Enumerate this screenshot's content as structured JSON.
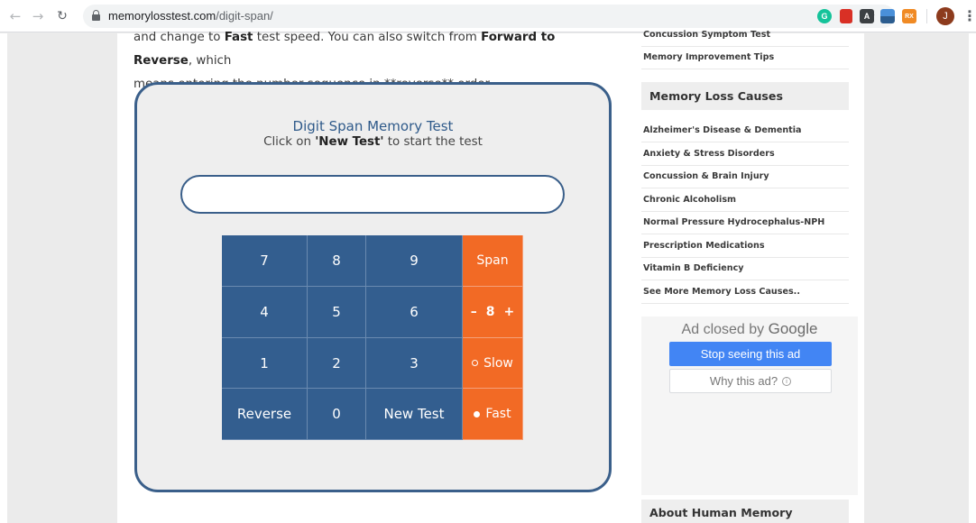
{
  "browser": {
    "url_host": "memorylosstest.com",
    "url_path": "/digit-span/",
    "profile_initial": "J",
    "extensions": [
      "grammarly-icon",
      "red-extension-icon",
      "a-extension-icon",
      "photo-extension-icon",
      "rx-extension-icon"
    ],
    "ext_rx_label": "RX",
    "ext_a_label": "A"
  },
  "article": {
    "line1_pre": "and change to ",
    "line1_bold1": "Fast",
    "line1_mid": " test speed. You can also switch from ",
    "line1_bold2": "Forward to Reverse",
    "line1_post": ", which",
    "line2": "means entering the number sequence in **reverse** order."
  },
  "test": {
    "title": "Digit Span Memory Test",
    "subtitle_pre": "Click on ",
    "subtitle_bold": "'New Test'",
    "subtitle_post": " to start the test",
    "display_value": ""
  },
  "keypad": {
    "keys": [
      {
        "label": "7",
        "name": "key-7"
      },
      {
        "label": "8",
        "name": "key-8"
      },
      {
        "label": "9",
        "name": "key-9"
      },
      {
        "label": "4",
        "name": "key-4"
      },
      {
        "label": "5",
        "name": "key-5"
      },
      {
        "label": "6",
        "name": "key-6"
      },
      {
        "label": "1",
        "name": "key-1"
      },
      {
        "label": "2",
        "name": "key-2"
      },
      {
        "label": "3",
        "name": "key-3"
      },
      {
        "label": "Reverse",
        "name": "reverse-button"
      },
      {
        "label": "0",
        "name": "key-0"
      },
      {
        "label": "New Test",
        "name": "new-test-button"
      }
    ],
    "span_label": "Span",
    "span_value": "8",
    "minus": "–",
    "plus": "+",
    "slow_label": "Slow",
    "fast_label": "Fast",
    "selected_speed": "Fast"
  },
  "sidebar": {
    "top_links": [
      "Concussion Symptom Test",
      "Memory Improvement Tips"
    ],
    "causes_header": "Memory Loss Causes",
    "causes": [
      "Alzheimer's Disease & Dementia",
      "Anxiety & Stress Disorders",
      "Concussion & Brain Injury",
      "Chronic Alcoholism",
      "Normal Pressure Hydrocephalus-NPH",
      "Prescription Medications",
      "Vitamin B Deficiency",
      "See More Memory Loss Causes.."
    ],
    "about_header": "About Human Memory"
  },
  "ad": {
    "closed_by": "Ad closed by",
    "google": "Google",
    "stop_label": "Stop seeing this ad",
    "why_label": "Why this ad?",
    "info_glyph": "i"
  },
  "colors": {
    "keypad_blue": "#335e8f",
    "keypad_orange": "#f26a25",
    "frame_blue": "#3a5f8a"
  }
}
